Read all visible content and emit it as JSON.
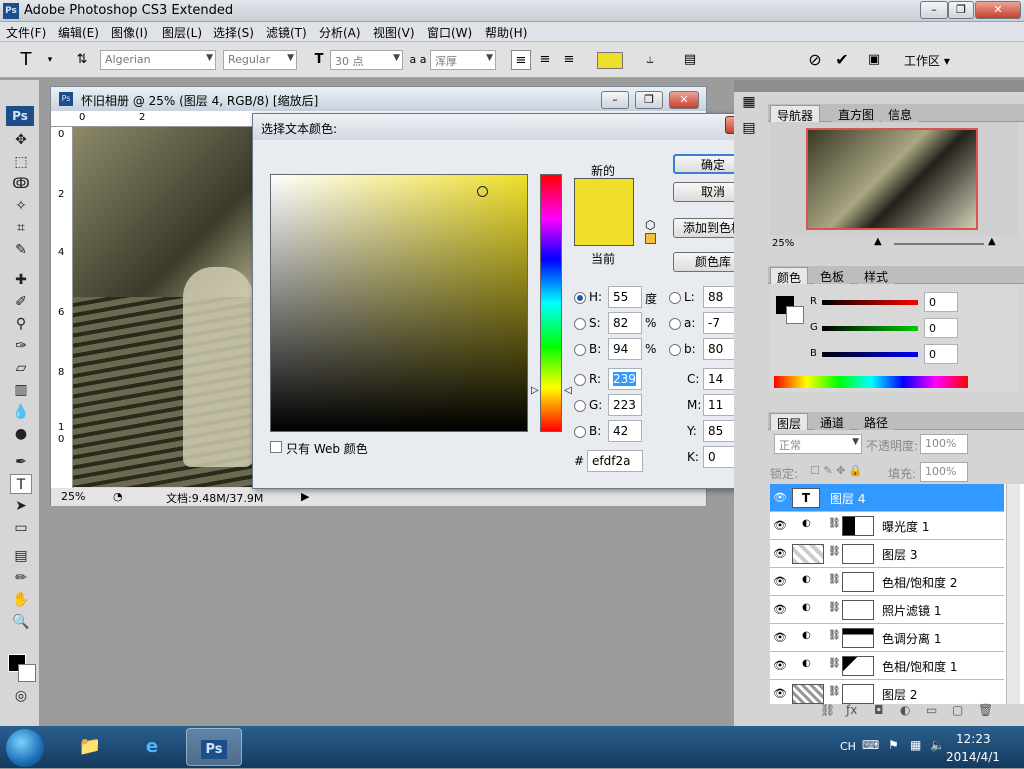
{
  "window": {
    "title": "Adobe Photoshop CS3 Extended",
    "logo": "Ps"
  },
  "menu": [
    "文件(F)",
    "编辑(E)",
    "图像(I)",
    "图层(L)",
    "选择(S)",
    "滤镜(T)",
    "分析(A)",
    "视图(V)",
    "窗口(W)",
    "帮助(H)"
  ],
  "options": {
    "tool_glyph": "T",
    "font_family": "Algerian",
    "font_style": "Regular",
    "font_size": "30 点",
    "antialias_label": "a a",
    "antialias": "浑厚",
    "workspace": "工作区 ▾"
  },
  "document": {
    "title": "怀旧相册 @ 25% (图层 4, RGB/8) [缩放后]",
    "zoom": "25%",
    "doc_info": "文档:9.48M/37.9M",
    "ruler_h": [
      "0",
      "2"
    ],
    "ruler_v": [
      "0",
      "2",
      "4",
      "6",
      "8",
      "1",
      "0"
    ]
  },
  "dialog": {
    "title": "选择文本颜色:",
    "new_label": "新的",
    "current_label": "当前",
    "new_color": "#efdf2a",
    "current_color": "#efdf2a",
    "ok": "确定",
    "cancel": "取消",
    "add_swatch": "添加到色板",
    "color_library": "颜色库",
    "web_only": "只有 Web 颜色",
    "hsb": [
      {
        "label": "H:",
        "value": "55",
        "unit": "度",
        "selected": true
      },
      {
        "label": "S:",
        "value": "82",
        "unit": "%",
        "selected": false
      },
      {
        "label": "B:",
        "value": "94",
        "unit": "%",
        "selected": false
      }
    ],
    "lab": [
      {
        "label": "L:",
        "value": "88"
      },
      {
        "label": "a:",
        "value": "-7"
      },
      {
        "label": "b:",
        "value": "80"
      }
    ],
    "rgb": [
      {
        "label": "R:",
        "value": "239"
      },
      {
        "label": "G:",
        "value": "223"
      },
      {
        "label": "B:",
        "value": "42"
      }
    ],
    "cmyk": [
      {
        "label": "C:",
        "value": "14",
        "unit": "%"
      },
      {
        "label": "M:",
        "value": "11",
        "unit": "%"
      },
      {
        "label": "Y:",
        "value": "85",
        "unit": "%"
      },
      {
        "label": "K:",
        "value": "0",
        "unit": "%"
      }
    ],
    "hex_label": "#",
    "hex": "efdf2a"
  },
  "navigator": {
    "tabs": [
      "导航器",
      "直方图",
      "信息"
    ],
    "zoom": "25%"
  },
  "color_panel": {
    "tabs": [
      "颜色",
      "色板",
      "样式"
    ],
    "r_label": "R",
    "g_label": "G",
    "b_label": "B",
    "r": "0",
    "g": "0",
    "b": "0"
  },
  "layers_panel": {
    "tabs": [
      "图层",
      "通道",
      "路径"
    ],
    "blend_mode": "正常",
    "opacity_label": "不透明度:",
    "opacity": "100%",
    "lock_label": "锁定:",
    "fill_label": "填充:",
    "fill": "100%",
    "layers": [
      {
        "name": "图层 4",
        "selected": true
      },
      {
        "name": "曝光度 1",
        "selected": false
      },
      {
        "name": "图层 3",
        "selected": false
      },
      {
        "name": "色相/饱和度 2",
        "selected": false
      },
      {
        "name": "照片滤镜 1",
        "selected": false
      },
      {
        "name": "色调分离 1",
        "selected": false
      },
      {
        "name": "色相/饱和度 1",
        "selected": false
      },
      {
        "name": "图层 2",
        "selected": false
      }
    ]
  },
  "taskbar": {
    "lang": "CH",
    "time": "12:23",
    "date": "2014/4/1",
    "ps_label": "Ps"
  }
}
